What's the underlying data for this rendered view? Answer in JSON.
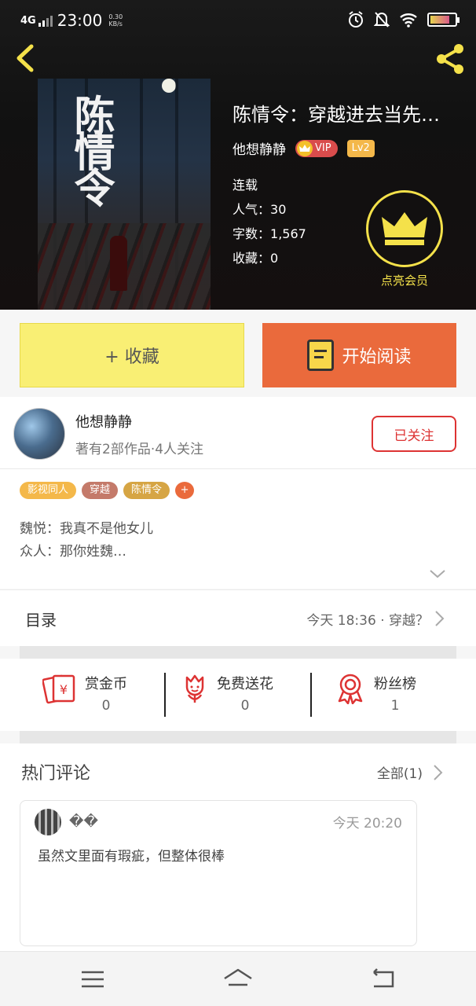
{
  "status_bar": {
    "network": "4G",
    "time": "23:00",
    "speed_value": "0.30",
    "speed_unit": "KB/s"
  },
  "book": {
    "title": "陈情令：穿越进去当先…",
    "author": "他想静静",
    "vip_label": "VIP",
    "level_label": "Lv2",
    "status": "连载",
    "popularity_label": "人气：",
    "popularity_value": "30",
    "word_count_label": "字数：",
    "word_count_value": "1,567",
    "collections_label": "收藏：",
    "collections_value": "0",
    "cover_title_art": "陈情令"
  },
  "member": {
    "label": "点亮会员"
  },
  "actions": {
    "collect_label": "+ 收藏",
    "read_label": "开始阅读"
  },
  "author_card": {
    "name": "他想静静",
    "subtitle": "著有2部作品·4人关注",
    "follow_label": "已关注"
  },
  "tags": [
    {
      "label": "影视同人",
      "color": "#f4b84a"
    },
    {
      "label": "穿越",
      "color": "#c47a6a"
    },
    {
      "label": "陈情令",
      "color": "#d6a544"
    },
    {
      "label": "+",
      "color": "#ea6a3c"
    }
  ],
  "intro": {
    "line1": "魏悦：我真不是他女儿",
    "line2": "众人：那你姓魏…"
  },
  "catalog": {
    "title": "目录",
    "latest": "今天  18:36 · 穿越？"
  },
  "stats": [
    {
      "label": "赏金币",
      "value": "0",
      "icon": "red-envelope-icon"
    },
    {
      "label": "免费送花",
      "value": "0",
      "icon": "flower-icon"
    },
    {
      "label": "粉丝榜",
      "value": "1",
      "icon": "medal-icon"
    }
  ],
  "hot_comments": {
    "title": "热门评论",
    "all_label": "全部(1)",
    "comment": {
      "user": "��",
      "time": "今天  20:20",
      "text": "虽然文里面有瑕疵，但整体很棒"
    }
  },
  "colors": {
    "accent_yellow": "#f9ef74",
    "accent_orange": "#ea6a3c",
    "member_gold": "#f4e14a",
    "follow_red": "#dd3333"
  }
}
